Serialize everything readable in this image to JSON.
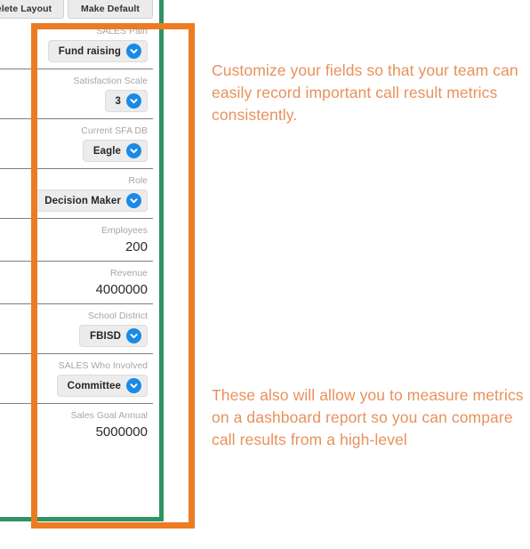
{
  "toolbar": {
    "delete_layout_label": "elete Layout",
    "make_default_label": "Make Default"
  },
  "form": {
    "fields": [
      {
        "label": "SALES Pain",
        "value": "Fund raising",
        "type": "dropdown"
      },
      {
        "label": "Satisfaction Scale",
        "value": "3",
        "type": "dropdown"
      },
      {
        "label": "Current SFA DB",
        "value": "Eagle",
        "type": "dropdown"
      },
      {
        "label": "Role",
        "value": "Decision Maker",
        "type": "dropdown"
      },
      {
        "label": "Employees",
        "value": "200",
        "type": "text"
      },
      {
        "label": "Revenue",
        "value": "4000000",
        "type": "text"
      },
      {
        "label": "School District",
        "value": "FBISD",
        "type": "dropdown"
      },
      {
        "label": "SALES Who Involved",
        "value": "Committee",
        "type": "dropdown"
      },
      {
        "label": "Sales Goal Annual",
        "value": "5000000",
        "type": "text"
      }
    ]
  },
  "annotations": {
    "orange_color": "#ec7b23",
    "green_color": "#2f9460",
    "text_color": "#e8915c",
    "callout_top": "Customize your fields so that your team can easily record important call result metrics consistently.",
    "callout_bottom": "These also will allow you to measure metrics on a dashboard report so you can compare call results from a high-level"
  },
  "icons": {
    "chevron_down": "chevron-down-icon"
  }
}
